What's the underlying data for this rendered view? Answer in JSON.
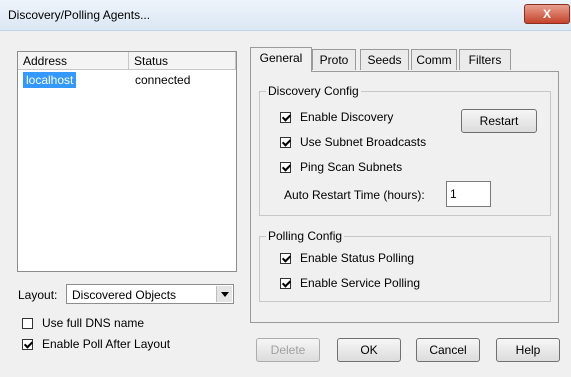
{
  "window": {
    "title": "Discovery/Polling Agents...",
    "close_label": "X"
  },
  "agents": {
    "columns": [
      "Address",
      "Status"
    ],
    "rows": [
      {
        "address": "localhost",
        "status": "connected",
        "selected": true
      }
    ]
  },
  "layout": {
    "label": "Layout:",
    "selected": "Discovered Objects"
  },
  "options": {
    "use_full_dns": {
      "label": "Use full DNS name",
      "checked": false
    },
    "enable_poll_after_layout": {
      "label": "Enable Poll After Layout",
      "checked": true
    }
  },
  "tabs": [
    {
      "label": "General",
      "active": true
    },
    {
      "label": "Proto",
      "active": false
    },
    {
      "label": "Seeds",
      "active": false
    },
    {
      "label": "Comm",
      "active": false
    },
    {
      "label": "Filters",
      "active": false
    }
  ],
  "discovery_config": {
    "title": "Discovery Config",
    "enable_discovery": {
      "label": "Enable Discovery",
      "checked": true
    },
    "use_subnet_broadcasts": {
      "label": "Use Subnet Broadcasts",
      "checked": true
    },
    "ping_scan_subnets": {
      "label": "Ping Scan Subnets",
      "checked": true
    },
    "restart_label": "Restart",
    "auto_restart_label": "Auto Restart Time (hours):",
    "auto_restart_value": "1"
  },
  "polling_config": {
    "title": "Polling Config",
    "enable_status_polling": {
      "label": "Enable Status Polling",
      "checked": true
    },
    "enable_service_polling": {
      "label": "Enable Service Polling",
      "checked": true
    }
  },
  "buttons": {
    "delete": "Delete",
    "ok": "OK",
    "cancel": "Cancel",
    "help": "Help"
  }
}
